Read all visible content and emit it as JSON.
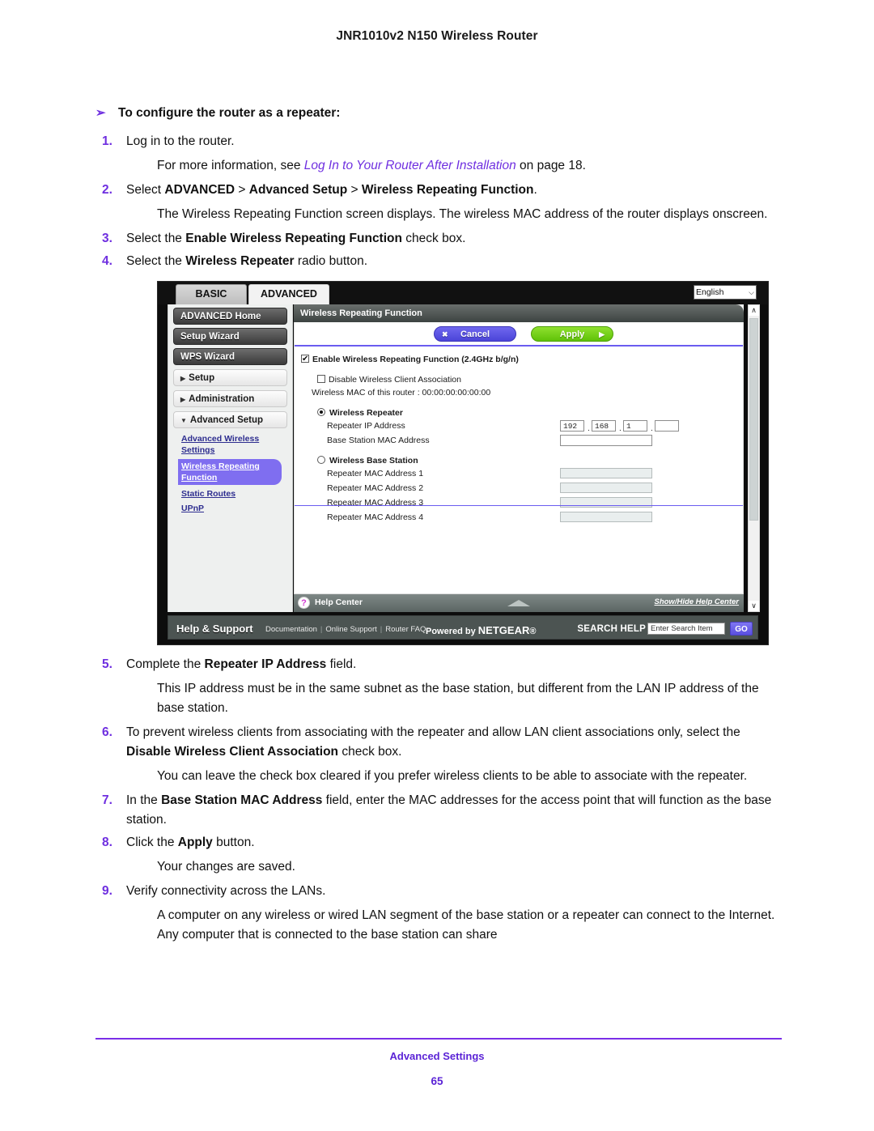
{
  "document": {
    "running_header": "JNR1010v2 N150 Wireless Router",
    "footer_title": "Advanced Settings",
    "page_number": "65",
    "procedure_heading": "To configure the router as a repeater:",
    "bullet_glyph": "➢"
  },
  "steps": {
    "s1_num": "1.",
    "s1_text": "Log in to the router.",
    "s1_note_pre": "For more information, see ",
    "s1_note_link": "Log In to Your Router After Installation",
    "s1_note_post": " on page 18.",
    "s2_num": "2.",
    "s2_pre": "Select ",
    "s2_bold1": "ADVANCED",
    "s2_mid1": " > ",
    "s2_bold2": "Advanced Setup",
    "s2_mid2": " > ",
    "s2_bold3": "Wireless Repeating Function",
    "s2_post": ".",
    "s2_note": "The Wireless Repeating Function screen displays. The wireless MAC address of the router displays onscreen.",
    "s3_num": "3.",
    "s3_pre": "Select the ",
    "s3_bold": "Enable Wireless Repeating Function",
    "s3_post": " check box.",
    "s4_num": "4.",
    "s4_pre": "Select the ",
    "s4_bold": "Wireless Repeater",
    "s4_post": " radio button.",
    "s5_num": "5.",
    "s5_pre": "Complete the ",
    "s5_bold": "Repeater IP Address",
    "s5_post": " field.",
    "s5_note": "This IP address must be in the same subnet as the base station, but different from the LAN IP address of the base station.",
    "s6_num": "6.",
    "s6_pre": "To prevent wireless clients from associating with the repeater and allow LAN client associations only, select the ",
    "s6_bold": "Disable Wireless Client Association",
    "s6_post": " check box.",
    "s6_note": "You can leave the check box cleared if you prefer wireless clients to be able to associate with the repeater.",
    "s7_num": "7.",
    "s7_pre": "In the ",
    "s7_bold": "Base Station MAC Address",
    "s7_post": " field, enter the MAC addresses for the access point that will function as the base station.",
    "s8_num": "8.",
    "s8_pre": "Click the ",
    "s8_bold": "Apply",
    "s8_post": " button.",
    "s8_note": "Your changes are saved.",
    "s9_num": "9.",
    "s9_text": "Verify connectivity across the LANs.",
    "s9_note": "A computer on any wireless or wired LAN segment of the base station or a repeater can connect to the Internet. Any computer that is connected to the base station can share"
  },
  "router_ui": {
    "tabs": {
      "basic": "BASIC",
      "advanced": "ADVANCED"
    },
    "language": {
      "value": "English",
      "caret": "⌵"
    },
    "nav_buttons": [
      "ADVANCED Home",
      "Setup Wizard",
      "WPS Wizard"
    ],
    "nav_sections": [
      {
        "label": "Setup",
        "tri": "▶"
      },
      {
        "label": "Administration",
        "tri": "▶"
      },
      {
        "label": "Advanced Setup",
        "tri": "▼"
      }
    ],
    "sublinks": [
      {
        "line1": "Advanced Wireless",
        "line2": "Settings",
        "selected": false
      },
      {
        "line1": "Wireless Repeating",
        "line2": "Function",
        "selected": true
      },
      {
        "line1": "Static Routes",
        "line2": "",
        "selected": false
      },
      {
        "line1": "UPnP",
        "line2": "",
        "selected": false
      }
    ],
    "pane_title": "Wireless Repeating Function",
    "cancel_button": "Cancel",
    "cancel_glyph": "✖",
    "apply_button": "Apply",
    "apply_glyph": "▶",
    "enable_checkbox_label": "Enable Wireless Repeating Function (2.4GHz b/g/n)",
    "enable_checkbox_checked": true,
    "disable_assoc_label": "Disable Wireless Client Association",
    "disable_assoc_checked": false,
    "mac_line": "Wireless MAC of this router : 00:00:00:00:00:00",
    "wireless_repeater_label": "Wireless Repeater",
    "wireless_repeater_selected": true,
    "repeater_ip_label": "Repeater IP Address",
    "repeater_ip_octets": [
      "192",
      "168",
      "1",
      ""
    ],
    "base_station_mac_label": "Base Station MAC Address",
    "base_station_mac_value": "",
    "wireless_base_station_label": "Wireless Base Station",
    "wireless_base_station_selected": false,
    "repeater_mac_labels": [
      "Repeater MAC Address 1",
      "Repeater MAC Address 2",
      "Repeater MAC Address 3",
      "Repeater MAC Address 4"
    ],
    "help_center_label": "Help Center",
    "help_center_icon": "?",
    "show_hide_help": "Show/Hide Help Center",
    "scroll_up_glyph": "∧",
    "scroll_down_glyph": "∨",
    "support": {
      "title": "Help & Support",
      "link1": "Documentation",
      "link2": "Online Support",
      "link3": "Router FAQ",
      "separator": "|",
      "powered_pre": "Powered by ",
      "powered_brand": "NETGEAR",
      "powered_mark": "®",
      "search_label": "SEARCH HELP",
      "search_placeholder": "Enter Search Item",
      "go_button": "GO"
    }
  },
  "colors": {
    "accent_purple": "#5b23d6",
    "link_purple": "#6f2fe0",
    "apply_green": "#6fd116",
    "cancel_blue": "#5a4fe0"
  }
}
